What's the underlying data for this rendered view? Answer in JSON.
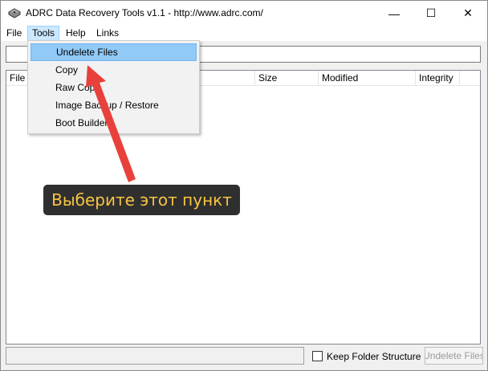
{
  "window": {
    "title": "ADRC Data Recovery Tools v1.1 - http://www.adrc.com/",
    "minimize_glyph": "—",
    "maximize_glyph": "☐",
    "close_glyph": "✕",
    "icon": "app-disk-icon"
  },
  "menubar": {
    "items": [
      {
        "label": "File"
      },
      {
        "label": "Tools"
      },
      {
        "label": "Help"
      },
      {
        "label": "Links"
      }
    ]
  },
  "tools_menu": {
    "items": [
      {
        "label": "Undelete Files"
      },
      {
        "label": "Copy"
      },
      {
        "label": "Raw Copy"
      },
      {
        "label": "Image Backup / Restore"
      },
      {
        "label": "Boot Builder"
      }
    ]
  },
  "list": {
    "columns": [
      {
        "label": "File"
      },
      {
        "label": "Size"
      },
      {
        "label": "Modified"
      },
      {
        "label": "Integrity"
      }
    ]
  },
  "bottom": {
    "keep_folder_label": "Keep Folder Structure",
    "keep_folder_checked": false,
    "undelete_button_label": "Undelete Files"
  },
  "annotation": {
    "callout_text": "Выберите этот пункт",
    "arrow_color": "#e8413c",
    "callout_text_color": "#f7c543"
  }
}
